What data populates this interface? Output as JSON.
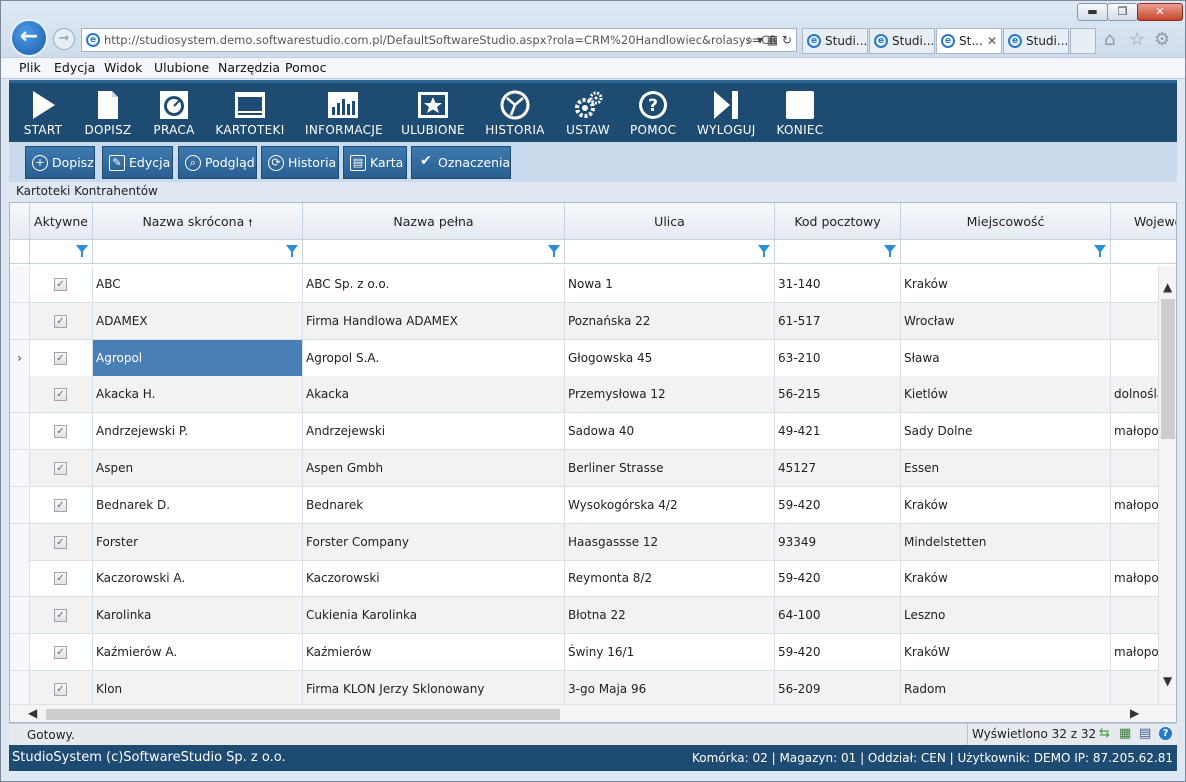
{
  "browser": {
    "address": "http://studiosystem.demo.softwarestudio.com.pl/DefaultSoftwareStudio.aspx?rola=CRM%20Handlowiec&rolasys=CR",
    "tabs": [
      "Studi...",
      "Studi...",
      "St...",
      "Studi..."
    ],
    "window_controls": {
      "minimize": "▬",
      "maximize": "❐",
      "close": "✕"
    }
  },
  "menu": [
    "Plik",
    "Edycja",
    "Widok",
    "Ulubione",
    "Narzędzia",
    "Pomoc"
  ],
  "toolbar": [
    {
      "label": "START",
      "icon": "play-icon"
    },
    {
      "label": "DOPISZ",
      "icon": "document-icon"
    },
    {
      "label": "PRACA",
      "icon": "gauge-icon"
    },
    {
      "label": "KARTOTEKI",
      "icon": "window-icon"
    },
    {
      "label": "INFORMACJE",
      "icon": "bar-chart-icon"
    },
    {
      "label": "ULUBIONE",
      "icon": "star-icon"
    },
    {
      "label": "HISTORIA",
      "icon": "history-icon"
    },
    {
      "label": "USTAW",
      "icon": "gears-icon"
    },
    {
      "label": "POMOC",
      "icon": "help-icon"
    },
    {
      "label": "WYLOGUJ",
      "icon": "logout-icon"
    },
    {
      "label": "KONIEC",
      "icon": "stop-icon"
    }
  ],
  "actions": [
    {
      "label": "Dopisz",
      "icon": "plus-icon"
    },
    {
      "label": "Edycja",
      "icon": "edit-icon"
    },
    {
      "label": "Podgląd",
      "icon": "magnifier-icon"
    },
    {
      "label": "Historia",
      "icon": "history-icon"
    },
    {
      "label": "Karta",
      "icon": "card-icon"
    },
    {
      "label": "Oznaczenia",
      "icon": "check-icon"
    }
  ],
  "breadcrumb": "Kartoteki Kontrahentów",
  "grid": {
    "columns": [
      "Aktywne",
      "Nazwa skrócona",
      "Nazwa pełna",
      "Ulica",
      "Kod pocztowy",
      "Miejscowość",
      "Wojewó"
    ],
    "sort_indicator": "🠕",
    "rows": [
      {
        "active": true,
        "short": "ABC",
        "full": "ABC Sp. z o.o.",
        "street": "Nowa 1",
        "postal": "31-140",
        "city": "Kraków",
        "region": ""
      },
      {
        "active": true,
        "short": "ADAMEX",
        "full": "Firma Handlowa ADAMEX",
        "street": "Poznańska 22",
        "postal": "61-517",
        "city": "Wrocław",
        "region": ""
      },
      {
        "active": true,
        "short": "Agropol",
        "full": "Agropol S.A.",
        "street": "Głogowska 45",
        "postal": "63-210",
        "city": "Sława",
        "region": "",
        "selected": true
      },
      {
        "active": true,
        "short": "Akacka H.",
        "full": "Akacka",
        "street": "Przemysłowa 12",
        "postal": "56-215",
        "city": "Kietlów",
        "region": "dolnośla"
      },
      {
        "active": true,
        "short": "Andrzejewski P.",
        "full": "Andrzejewski",
        "street": "Sadowa 40",
        "postal": "49-421",
        "city": "Sady Dolne",
        "region": "małopol"
      },
      {
        "active": true,
        "short": "Aspen",
        "full": "Aspen Gmbh",
        "street": "Berliner Strasse",
        "postal": "45127",
        "city": "Essen",
        "region": ""
      },
      {
        "active": true,
        "short": "Bednarek D.",
        "full": "Bednarek",
        "street": "Wysokogórska 4/2",
        "postal": "59-420",
        "city": "Kraków",
        "region": "małopol"
      },
      {
        "active": true,
        "short": "Forster",
        "full": "Forster Company",
        "street": "Haasgassse 12",
        "postal": "93349",
        "city": "Mindelstetten",
        "region": ""
      },
      {
        "active": true,
        "short": "Kaczorowski A.",
        "full": "Kaczorowski",
        "street": "Reymonta 8/2",
        "postal": "59-420",
        "city": "Kraków",
        "region": "małopol"
      },
      {
        "active": true,
        "short": "Karolinka",
        "full": "Cukienia Karolinka",
        "street": "Błotna 22",
        "postal": "64-100",
        "city": "Leszno",
        "region": ""
      },
      {
        "active": true,
        "short": "Kaźmierów A.",
        "full": "Kaźmierów",
        "street": "Świny 16/1",
        "postal": "59-420",
        "city": "KrakóW",
        "region": "małopol"
      },
      {
        "active": true,
        "short": "Klon",
        "full": "Firma KLON Jerzy Sklonowany",
        "street": "3-go Maja 96",
        "postal": "56-209",
        "city": "Radom",
        "region": ""
      }
    ]
  },
  "status": {
    "ready": "Gotowy.",
    "count": "Wyświetlono 32 z 32"
  },
  "footer": {
    "left": "StudioSystem (c)SoftwareStudio Sp. z o.o.",
    "right": "Komórka: 02 | Magazyn: 01 | Oddział: CEN | Użytkownik: DEMO IP: 87.205.62.81"
  }
}
